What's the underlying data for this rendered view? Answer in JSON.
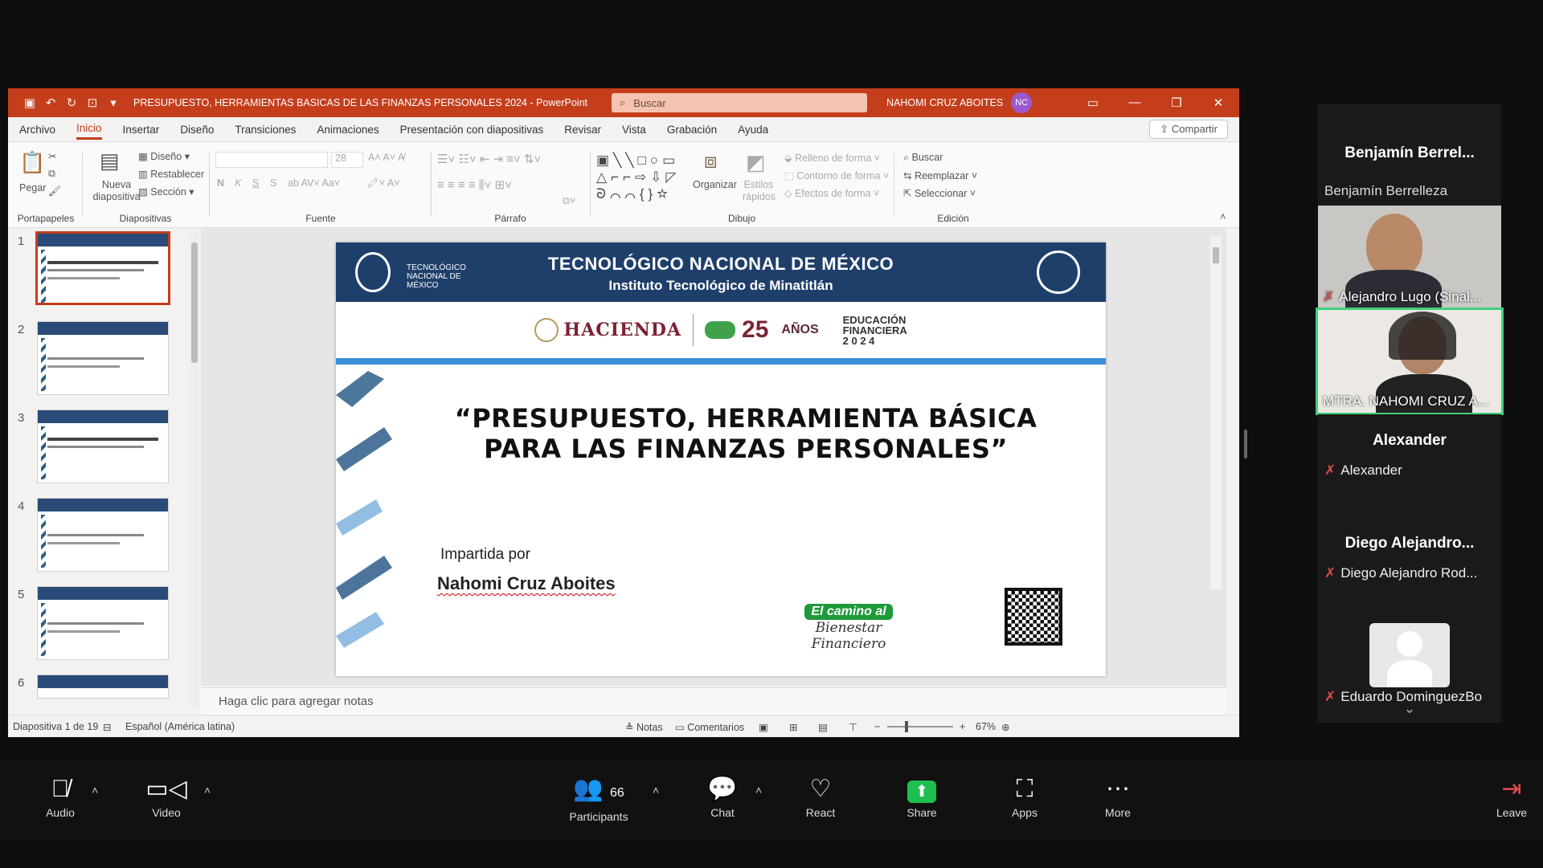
{
  "app": {
    "doc_title": "PRESUPUESTO, HERRAMIENTAS BASICAS DE LAS FINANZAS PERSONALES 2024 - PowerPoint",
    "search_placeholder": "Buscar",
    "user": "NAHOMI CRUZ ABOITES",
    "user_initials": "NC",
    "accent": "#c43e1c"
  },
  "menu": [
    "Archivo",
    "Inicio",
    "Insertar",
    "Diseño",
    "Transiciones",
    "Animaciones",
    "Presentación con diapositivas",
    "Revisar",
    "Vista",
    "Grabación",
    "Ayuda"
  ],
  "share_label": "Compartir",
  "ribbon": {
    "portapapeles": {
      "label": "Portapapeles",
      "pegar": "Pegar"
    },
    "diapositivas": {
      "label": "Diapositivas",
      "nueva": "Nueva diapositiva",
      "diseno": "Diseño",
      "restablecer": "Restablecer",
      "seccion": "Sección"
    },
    "fuente": {
      "label": "Fuente",
      "bold": "N",
      "italic": "K",
      "under": "S",
      "strike": "S",
      "font_size": "28"
    },
    "parrafo": {
      "label": "Párrafo"
    },
    "dibujo": {
      "label": "Dibujo",
      "organizar": "Organizar",
      "estilos": "Estilos rápidos",
      "relleno": "Relleno de forma",
      "contorno": "Contorno de forma",
      "efectos": "Efectos de forma"
    },
    "edicion": {
      "label": "Edición",
      "buscar": "Buscar",
      "reemplazar": "Reemplazar",
      "seleccionar": "Seleccionar"
    }
  },
  "thumbnails": [
    "1",
    "2",
    "3",
    "4",
    "5",
    "6"
  ],
  "slide": {
    "header1": "TECNOLÓGICO NACIONAL DE MÉXICO",
    "header2": "Instituto Tecnológico de Minatitlán",
    "tecnm_small": "TECNOLÓGICO NACIONAL DE MÉXICO",
    "hacienda": "HACIENDA",
    "anos": "AÑOS",
    "anos_num": "25",
    "educacion": "EDUCACIÓN FINANCIERA",
    "edu_year": "2 0 2 4",
    "title_line1": "“PRESUPUESTO, HERRAMIENTA  BÁSICA",
    "title_line2": "PARA LAS FINANZAS PERSONALES”",
    "impartida": "Impartida por",
    "presenter": "Nahomi Cruz Aboites",
    "bienestar1": "El camino al",
    "bienestar2": "Bienestar Financiero"
  },
  "notes_placeholder": "Haga clic para agregar notas",
  "status": {
    "slide_count": "Diapositiva 1 de 19",
    "language": "Español (América latina)",
    "notas": "Notas",
    "comentarios": "Comentarios",
    "zoom": "67%"
  },
  "participants": [
    {
      "title": "Benjamín  Berrel...",
      "label": "Benjamín Berrelleza"
    },
    {
      "label": "Alejandro Lugo (Sinal..."
    },
    {
      "label": "MTRA. NAHOMI CRUZ A..."
    },
    {
      "title": "Alexander",
      "label": "Alexander"
    },
    {
      "title": "Diego  Alejandro...",
      "label": "Diego Alejandro Rod..."
    },
    {
      "label": "Eduardo DominguezBo"
    }
  ],
  "toolbar": {
    "audio": "Audio",
    "video": "Video",
    "participants": "Participants",
    "participants_count": "66",
    "chat": "Chat",
    "react": "React",
    "share": "Share",
    "apps": "Apps",
    "more": "More",
    "leave": "Leave",
    "share_color": "#1fbf4f"
  }
}
